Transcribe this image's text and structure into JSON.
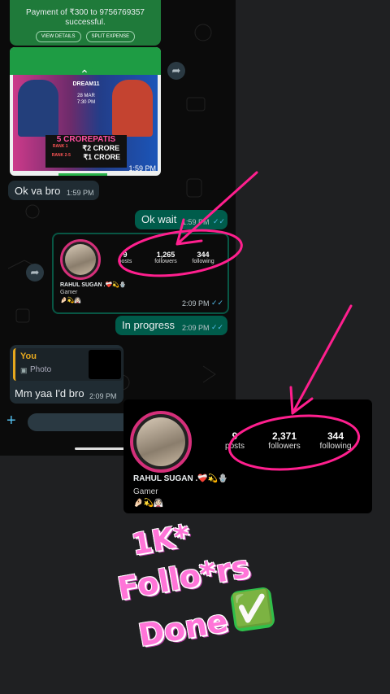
{
  "payment": {
    "text": "Payment of ₹300 to 9756769357 successful.",
    "view_details": "VIEW DETAILS",
    "split_expense": "SPLIT EXPENSE"
  },
  "image_card": {
    "time": "1:59 PM",
    "brand": "DREAM11",
    "date": "28 MAR",
    "match_time": "7:30 PM",
    "headline": "5 CROREPATIS",
    "rank1_label": "RANK 1",
    "rank1_amount": "₹2 CRORE",
    "rank2_label": "RANK 2-5",
    "rank2_amount": "₹1 CRORE"
  },
  "messages": [
    {
      "text": "Ok va bro",
      "time": "1:59 PM"
    },
    {
      "text": "Ok wait",
      "time": "1:59 PM"
    },
    {
      "text": "In progress",
      "time": "2:09 PM"
    },
    {
      "text": "Mm yaa I'd bro",
      "time": "2:09 PM"
    }
  ],
  "profile_small": {
    "posts": "9",
    "posts_label": "posts",
    "followers": "1,265",
    "followers_label": "followers",
    "following": "344",
    "following_label": "following",
    "name": "RAHUL SUGAN .❤️‍🩹💫🪬",
    "bio": "Gamer",
    "emoji": "🤌🏻💫👰🏻",
    "time": "2:09 PM"
  },
  "reply": {
    "author": "You",
    "type": "Photo"
  },
  "profile_big": {
    "posts": "9",
    "posts_label": "posts",
    "followers": "2,371",
    "followers_label": "followers",
    "following": "344",
    "following_label": "following",
    "name": "RAHUL SUGAN .❤️‍🩹💫🪬",
    "bio": "Gamer",
    "emoji": "🤌🏻💫👰🏻"
  },
  "sticker": {
    "line1": "1K*",
    "line2": "Follo*rs",
    "line3": "Done",
    "check": "✅"
  },
  "icons": {
    "plus": "plus-icon",
    "forward": "forward-icon",
    "camera": "camera-icon"
  },
  "colors": {
    "accent_pink": "#ff1f8e",
    "outgoing": "#005c4b",
    "incoming": "#202c33"
  }
}
